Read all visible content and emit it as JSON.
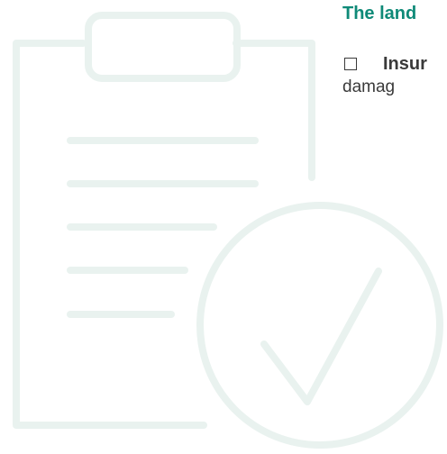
{
  "heading": {
    "text": "The land",
    "color": "#0f8a78"
  },
  "checklist": {
    "item_title": "Insur",
    "item_text": "damag",
    "checked": false
  },
  "illustration": {
    "name": "clipboard-check",
    "stroke_color": "#e9f2ef"
  }
}
